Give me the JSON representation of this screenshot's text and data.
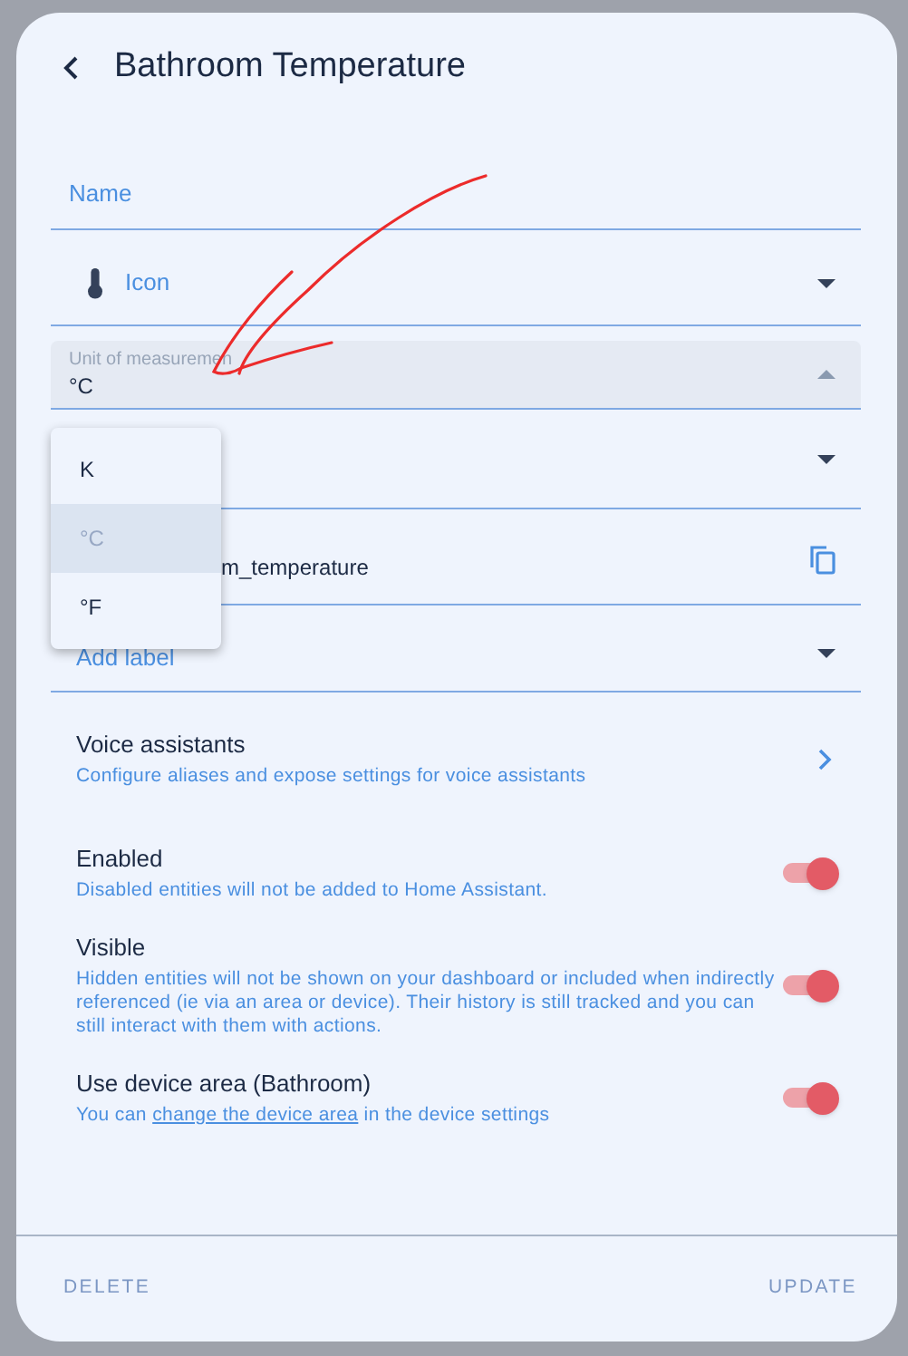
{
  "header": {
    "title": "Bathroom Temperature"
  },
  "fields": [
    {
      "kind": "text",
      "label": "Name"
    },
    {
      "kind": "icon",
      "label": "Icon"
    },
    {
      "kind": "unit",
      "label": "Unit of measuremen",
      "value": "°C",
      "expanded": true
    },
    {
      "kind": "select"
    },
    {
      "kind": "entity",
      "value": "m_temperature"
    },
    {
      "kind": "select",
      "placeholder": "Add label"
    }
  ],
  "menu": [
    {
      "label": "K",
      "selected": false
    },
    {
      "label": "°C",
      "selected": true
    },
    {
      "label": "°F",
      "selected": false
    }
  ],
  "settings": [
    {
      "kind": "link",
      "title": "Voice assistants",
      "subtitle": "Configure aliases and expose settings for voice assistants"
    },
    {
      "kind": "toggle",
      "title": "Enabled",
      "subtitle": "Disabled entities will not be added to Home Assistant.",
      "on": true
    },
    {
      "kind": "toggle",
      "title": "Visible",
      "subtitle": "Hidden entities will not be shown on your dashboard or included when indirectly referenced (ie via an area or device). Their history is still tracked and you can still interact with them with actions.",
      "on": true
    },
    {
      "kind": "toggle",
      "title": "Use device area (Bathroom)",
      "subtitle_before": "You can",
      "subtitle_link": "change the device area",
      "subtitle_after": "in the device settings",
      "on": true
    }
  ],
  "footer": {
    "buttons": [
      "DELETE",
      "UPDATE"
    ]
  }
}
